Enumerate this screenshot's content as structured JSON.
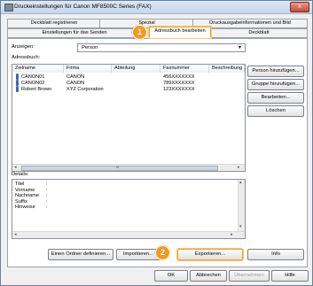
{
  "window": {
    "title": "Druckeinstellungen für Canon MF8500C Series (FAX)",
    "close_label": "x"
  },
  "tabs_back": [
    {
      "label": "Deckblatt registrieren"
    },
    {
      "label": "Spezial"
    },
    {
      "label": "Druckausgabeinformationen und Bild"
    }
  ],
  "tabs_front": [
    {
      "label": "Einstellungen für das Senden"
    },
    {
      "label": "Adressbuch bearbeiten"
    },
    {
      "label": "Deckblatt"
    }
  ],
  "display": {
    "label": "Anzeigen:",
    "value": "Person",
    "arrow": "▼"
  },
  "addressbook": {
    "label": "Adressbuch:",
    "columns": [
      "Zielname",
      "Firma",
      "Abteilung",
      "Faxnummer",
      "Beschreibung"
    ],
    "rows": [
      {
        "name": "CANON01",
        "company": "CANON",
        "dept": "",
        "fax": "456XXXXXXX",
        "desc": ""
      },
      {
        "name": "CANON02",
        "company": "CANON",
        "dept": "",
        "fax": "789XXXXXXX",
        "desc": ""
      },
      {
        "name": "Robert Brown",
        "company": "XYZ Corporation",
        "dept": "",
        "fax": "123XXXXXXX",
        "desc": ""
      }
    ]
  },
  "side_buttons": [
    {
      "label": "Person hinzufügen..."
    },
    {
      "label": "Gruppe hinzufügen..."
    },
    {
      "label": "Bearbeiten..."
    },
    {
      "label": "Löschen"
    }
  ],
  "details": {
    "label": "Details:",
    "fields": [
      "Titel",
      "Vorname",
      "Nachname",
      "Suffix",
      "Hinweise"
    ],
    "colon": ":"
  },
  "bottom_buttons": {
    "define_folder": "Einen Ordner definieren...",
    "import": "Importieren...",
    "export": "Exportieren...",
    "info": "Info"
  },
  "dialog_buttons": {
    "ok": "OK",
    "cancel": "Abbrechen",
    "apply": "Übernehmen",
    "help": "Hilfe"
  },
  "callouts": {
    "one": "1",
    "two": "2"
  },
  "scroll_glyphs": {
    "left": "◂",
    "right": "▸",
    "up": "▴",
    "down": "▾",
    "grip": "III"
  },
  "colors": {
    "accent": "#f29a1e",
    "title_bg": "#c6d7ec",
    "close": "#c54a33"
  }
}
